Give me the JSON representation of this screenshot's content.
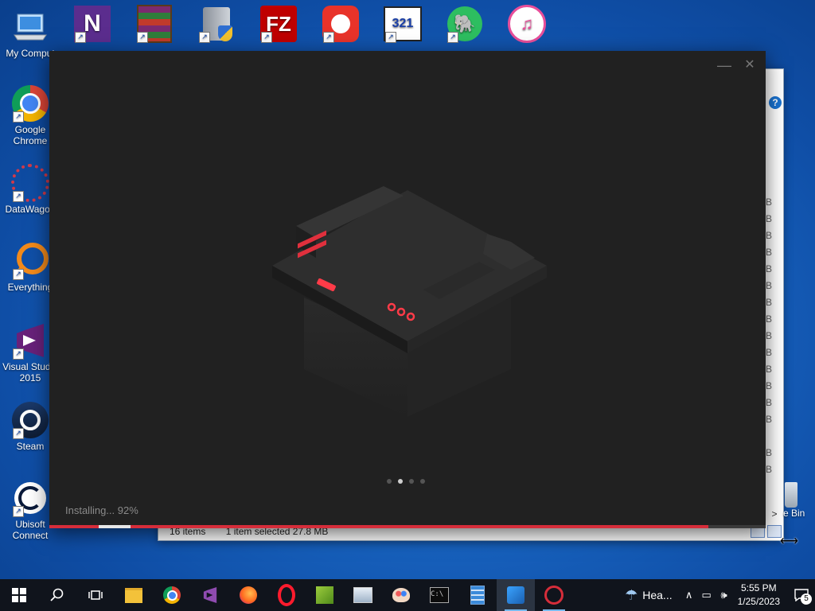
{
  "desktop": {
    "icons_top": [
      "My Comput",
      "NVDA",
      "WinRAR",
      "Process...",
      "FileZilla",
      "GOM Pl...",
      "Media Pl...",
      "Evernote",
      "iTunes"
    ],
    "icons_left": [
      "Google Chrome",
      "DataWagon",
      "Everything",
      "Visual Studio 2015",
      "Steam",
      "Ubisoft Connect"
    ],
    "recycle_bin_label": "e Bin"
  },
  "explorer": {
    "help_icon": "?",
    "sizes": [
      "B",
      "B",
      "B",
      "B",
      "B",
      "B",
      "B",
      "B",
      "B",
      "B",
      "B",
      "B",
      "B",
      "B",
      "",
      "B",
      "B"
    ],
    "scroll_right": ">",
    "status_items": "16 items",
    "status_selected": "1 item selected  27.8 MB"
  },
  "installer": {
    "minimize": "—",
    "close": "✕",
    "status": "Installing... 92%",
    "progress": 0.92,
    "slides_total": 4,
    "slide_active": 1,
    "accent_color": "#d62d3a"
  },
  "taskbar": {
    "weather": "Hea...",
    "time": "5:55 PM",
    "date": "1/25/2023",
    "notifications": "5"
  }
}
